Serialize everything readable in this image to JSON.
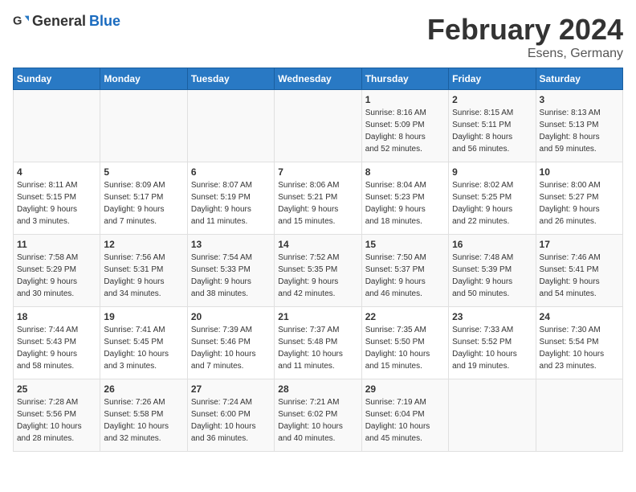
{
  "header": {
    "logo_general": "General",
    "logo_blue": "Blue",
    "title": "February 2024",
    "subtitle": "Esens, Germany"
  },
  "weekdays": [
    "Sunday",
    "Monday",
    "Tuesday",
    "Wednesday",
    "Thursday",
    "Friday",
    "Saturday"
  ],
  "weeks": [
    [
      {
        "day": "",
        "info": ""
      },
      {
        "day": "",
        "info": ""
      },
      {
        "day": "",
        "info": ""
      },
      {
        "day": "",
        "info": ""
      },
      {
        "day": "1",
        "info": "Sunrise: 8:16 AM\nSunset: 5:09 PM\nDaylight: 8 hours\nand 52 minutes."
      },
      {
        "day": "2",
        "info": "Sunrise: 8:15 AM\nSunset: 5:11 PM\nDaylight: 8 hours\nand 56 minutes."
      },
      {
        "day": "3",
        "info": "Sunrise: 8:13 AM\nSunset: 5:13 PM\nDaylight: 8 hours\nand 59 minutes."
      }
    ],
    [
      {
        "day": "4",
        "info": "Sunrise: 8:11 AM\nSunset: 5:15 PM\nDaylight: 9 hours\nand 3 minutes."
      },
      {
        "day": "5",
        "info": "Sunrise: 8:09 AM\nSunset: 5:17 PM\nDaylight: 9 hours\nand 7 minutes."
      },
      {
        "day": "6",
        "info": "Sunrise: 8:07 AM\nSunset: 5:19 PM\nDaylight: 9 hours\nand 11 minutes."
      },
      {
        "day": "7",
        "info": "Sunrise: 8:06 AM\nSunset: 5:21 PM\nDaylight: 9 hours\nand 15 minutes."
      },
      {
        "day": "8",
        "info": "Sunrise: 8:04 AM\nSunset: 5:23 PM\nDaylight: 9 hours\nand 18 minutes."
      },
      {
        "day": "9",
        "info": "Sunrise: 8:02 AM\nSunset: 5:25 PM\nDaylight: 9 hours\nand 22 minutes."
      },
      {
        "day": "10",
        "info": "Sunrise: 8:00 AM\nSunset: 5:27 PM\nDaylight: 9 hours\nand 26 minutes."
      }
    ],
    [
      {
        "day": "11",
        "info": "Sunrise: 7:58 AM\nSunset: 5:29 PM\nDaylight: 9 hours\nand 30 minutes."
      },
      {
        "day": "12",
        "info": "Sunrise: 7:56 AM\nSunset: 5:31 PM\nDaylight: 9 hours\nand 34 minutes."
      },
      {
        "day": "13",
        "info": "Sunrise: 7:54 AM\nSunset: 5:33 PM\nDaylight: 9 hours\nand 38 minutes."
      },
      {
        "day": "14",
        "info": "Sunrise: 7:52 AM\nSunset: 5:35 PM\nDaylight: 9 hours\nand 42 minutes."
      },
      {
        "day": "15",
        "info": "Sunrise: 7:50 AM\nSunset: 5:37 PM\nDaylight: 9 hours\nand 46 minutes."
      },
      {
        "day": "16",
        "info": "Sunrise: 7:48 AM\nSunset: 5:39 PM\nDaylight: 9 hours\nand 50 minutes."
      },
      {
        "day": "17",
        "info": "Sunrise: 7:46 AM\nSunset: 5:41 PM\nDaylight: 9 hours\nand 54 minutes."
      }
    ],
    [
      {
        "day": "18",
        "info": "Sunrise: 7:44 AM\nSunset: 5:43 PM\nDaylight: 9 hours\nand 58 minutes."
      },
      {
        "day": "19",
        "info": "Sunrise: 7:41 AM\nSunset: 5:45 PM\nDaylight: 10 hours\nand 3 minutes."
      },
      {
        "day": "20",
        "info": "Sunrise: 7:39 AM\nSunset: 5:46 PM\nDaylight: 10 hours\nand 7 minutes."
      },
      {
        "day": "21",
        "info": "Sunrise: 7:37 AM\nSunset: 5:48 PM\nDaylight: 10 hours\nand 11 minutes."
      },
      {
        "day": "22",
        "info": "Sunrise: 7:35 AM\nSunset: 5:50 PM\nDaylight: 10 hours\nand 15 minutes."
      },
      {
        "day": "23",
        "info": "Sunrise: 7:33 AM\nSunset: 5:52 PM\nDaylight: 10 hours\nand 19 minutes."
      },
      {
        "day": "24",
        "info": "Sunrise: 7:30 AM\nSunset: 5:54 PM\nDaylight: 10 hours\nand 23 minutes."
      }
    ],
    [
      {
        "day": "25",
        "info": "Sunrise: 7:28 AM\nSunset: 5:56 PM\nDaylight: 10 hours\nand 28 minutes."
      },
      {
        "day": "26",
        "info": "Sunrise: 7:26 AM\nSunset: 5:58 PM\nDaylight: 10 hours\nand 32 minutes."
      },
      {
        "day": "27",
        "info": "Sunrise: 7:24 AM\nSunset: 6:00 PM\nDaylight: 10 hours\nand 36 minutes."
      },
      {
        "day": "28",
        "info": "Sunrise: 7:21 AM\nSunset: 6:02 PM\nDaylight: 10 hours\nand 40 minutes."
      },
      {
        "day": "29",
        "info": "Sunrise: 7:19 AM\nSunset: 6:04 PM\nDaylight: 10 hours\nand 45 minutes."
      },
      {
        "day": "",
        "info": ""
      },
      {
        "day": "",
        "info": ""
      }
    ]
  ]
}
